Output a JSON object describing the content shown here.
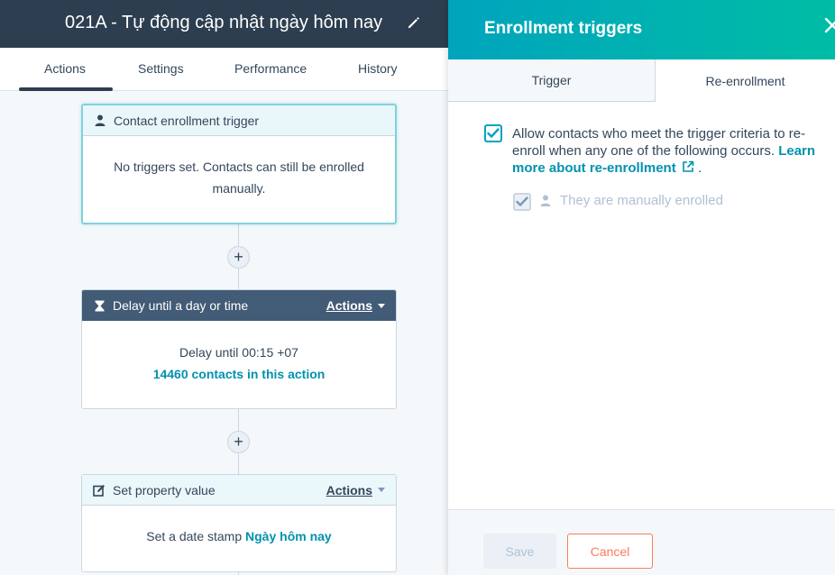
{
  "header": {
    "title": "021A - Tự động cập nhật ngày hôm nay"
  },
  "tabs": [
    "Actions",
    "Settings",
    "Performance",
    "History"
  ],
  "workflow": {
    "trigger_card": {
      "title": "Contact enrollment trigger",
      "body": "No triggers set. Contacts can still be enrolled manually."
    },
    "delay_card": {
      "title": "Delay until a day or time",
      "actions_label": "Actions",
      "delay_prefix": "Delay until",
      "delay_time": "00:15 +07",
      "contacts_link": "14460 contacts in this action"
    },
    "property_card": {
      "title": "Set property value",
      "actions_label": "Actions",
      "body_prefix": "Set a date stamp",
      "property_name": "Ngày hôm nay"
    },
    "add_symbol": "+"
  },
  "panel": {
    "title": "Enrollment triggers",
    "tabs": {
      "trigger": "Trigger",
      "reenrollment": "Re-enrollment"
    },
    "allow_text": "Allow contacts who meet the trigger criteria to re-enroll when any one of the following occurs.",
    "learn_more": "Learn more about re-enrollment",
    "learn_more_suffix": ".",
    "option_manual": "They are manually enrolled",
    "allow_checked": true,
    "manual_checked": true,
    "buttons": {
      "save": "Save",
      "cancel": "Cancel"
    }
  },
  "colors": {
    "topbar": "#2d3e50",
    "accent_teal": "#00a4bd",
    "link": "#0091ae",
    "cancel": "#ff7a59",
    "dark_header": "#425b76"
  },
  "icons": [
    "edit-pencil-icon",
    "contact-icon",
    "hourglass-icon",
    "edit-box-icon",
    "close-icon",
    "external-link-icon",
    "checkmark-icon",
    "person-icon",
    "caret-down-icon"
  ]
}
